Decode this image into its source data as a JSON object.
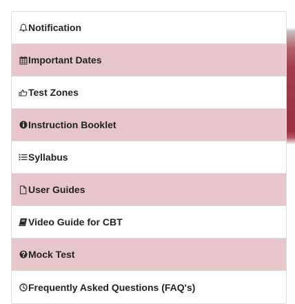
{
  "menu": {
    "items": [
      {
        "label": "Notification",
        "icon": "bell-icon"
      },
      {
        "label": "Important Dates",
        "icon": "calendar-icon"
      },
      {
        "label": "Test Zones",
        "icon": "hand-pointer-icon"
      },
      {
        "label": "Instruction Booklet",
        "icon": "info-circle-icon"
      },
      {
        "label": "Syllabus",
        "icon": "list-icon"
      },
      {
        "label": "User Guides",
        "icon": "file-icon"
      },
      {
        "label": "Video Guide for CBT",
        "icon": "book-icon"
      },
      {
        "label": "Mock Test",
        "icon": "question-circle-icon"
      },
      {
        "label": "Frequently Asked Questions (FAQ's)",
        "icon": "clock-icon"
      }
    ]
  },
  "colors": {
    "alt_row": "#e6c5cb",
    "accent": "#a23a4a",
    "text": "#222222"
  }
}
